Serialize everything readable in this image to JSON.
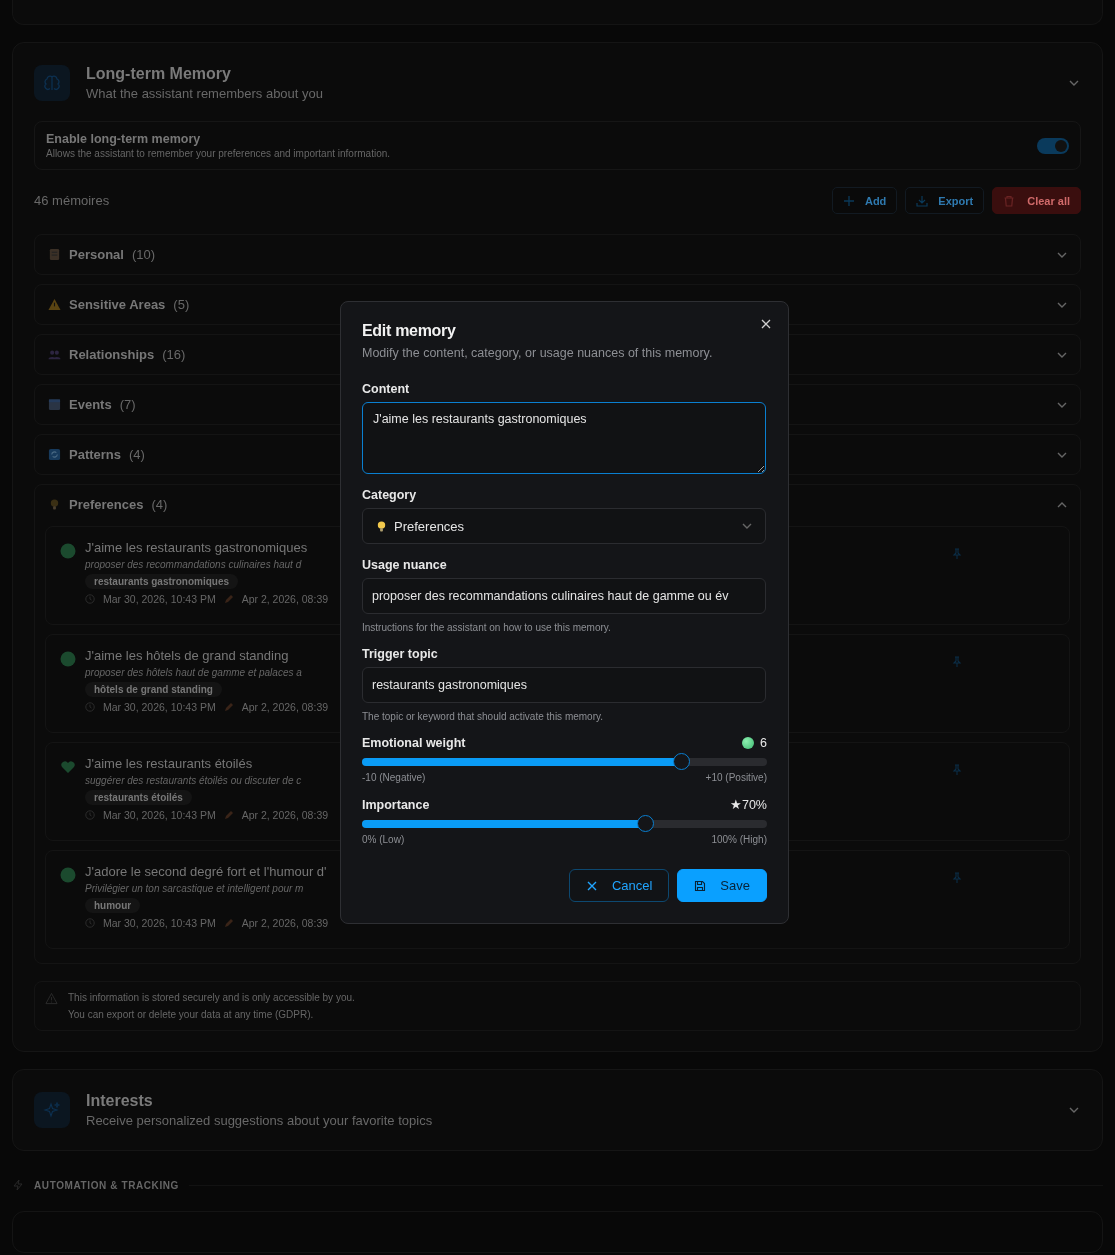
{
  "memory_section": {
    "title": "Long-term Memory",
    "subtitle": "What the assistant remembers about you",
    "expanded": false,
    "toggle": {
      "label": "Enable long-term memory",
      "description": "Allows the assistant to remember your preferences and important information.",
      "on": true
    },
    "count": "46 mémoires",
    "actions": [
      {
        "kind": "add",
        "label": "Add"
      },
      {
        "kind": "export",
        "label": "Export"
      },
      {
        "kind": "clear",
        "label": "Clear all"
      }
    ],
    "categories": [
      {
        "kind": "personal",
        "name": "Personal",
        "count": "(10)",
        "expanded": false
      },
      {
        "kind": "sensitive",
        "name": "Sensitive Areas",
        "count": "(5)",
        "expanded": false
      },
      {
        "kind": "relationships",
        "name": "Relationships",
        "count": "(16)",
        "expanded": false
      },
      {
        "kind": "events",
        "name": "Events",
        "count": "(7)",
        "expanded": false
      },
      {
        "kind": "patterns",
        "name": "Patterns",
        "count": "(4)",
        "expanded": false
      },
      {
        "kind": "preferences",
        "name": "Preferences",
        "count": "(4)",
        "expanded": true,
        "memories": [
          {
            "kind": "dot",
            "content": "J'aime les restaurants gastronomiques",
            "nuance": "proposer des recommandations culinaires haut d",
            "tag": "restaurants gastronomiques",
            "created": "Mar 30, 2026, 10:43 PM",
            "edited": "Apr 2, 2026, 08:39"
          },
          {
            "kind": "dot",
            "content": "J'aime les hôtels de grand standing",
            "nuance": "proposer des hôtels haut de gamme et palaces a",
            "tag": "hôtels de grand standing",
            "created": "Mar 30, 2026, 10:43 PM",
            "edited": "Apr 2, 2026, 08:39"
          },
          {
            "kind": "heart",
            "content": "J'aime les restaurants étoilés",
            "nuance": "suggérer des restaurants étoilés ou discuter de c",
            "tag": "restaurants étoilés",
            "created": "Mar 30, 2026, 10:43 PM",
            "edited": "Apr 2, 2026, 08:39"
          },
          {
            "kind": "dot",
            "content": "J'adore le second degré fort et l'humour d'",
            "nuance": "Privilégier un ton sarcastique et intelligent pour m",
            "tag": "humour",
            "created": "Mar 30, 2026, 10:43 PM",
            "edited": "Apr 2, 2026, 08:39"
          }
        ]
      }
    ],
    "notice": [
      "This information is stored securely and is only accessible by you.",
      "You can export or delete your data at any time (GDPR)."
    ]
  },
  "interests_section": {
    "title": "Interests",
    "subtitle": "Receive personalized suggestions about your favorite topics",
    "expanded": false
  },
  "automation_heading": "AUTOMATION & TRACKING",
  "dialog": {
    "title": "Edit memory",
    "subtitle": "Modify the content, category, or usage nuances of this memory.",
    "content": {
      "label": "Content",
      "value": "J'aime les restaurants gastronomiques"
    },
    "category": {
      "label": "Category",
      "value": "Preferences"
    },
    "usage": {
      "label": "Usage nuance",
      "value": "proposer des recommandations culinaires haut de gamme ou év",
      "hint": "Instructions for the assistant on how to use this memory."
    },
    "trigger": {
      "label": "Trigger topic",
      "value": "restaurants gastronomiques",
      "hint": "The topic or keyword that should activate this memory."
    },
    "sliders": [
      {
        "kind": "emotion",
        "label": "Emotional weight",
        "reading": "6",
        "level": 0.79,
        "min_label": "-10 (Negative)",
        "max_label": "+10 (Positive)"
      },
      {
        "kind": "importance",
        "label": "Importance",
        "reading": "★70%",
        "level": 0.7,
        "min_label": "0% (Low)",
        "max_label": "100% (High)"
      }
    ],
    "buttons": [
      {
        "kind": "cancel",
        "label": "Cancel"
      },
      {
        "kind": "save",
        "label": "Save"
      }
    ]
  }
}
